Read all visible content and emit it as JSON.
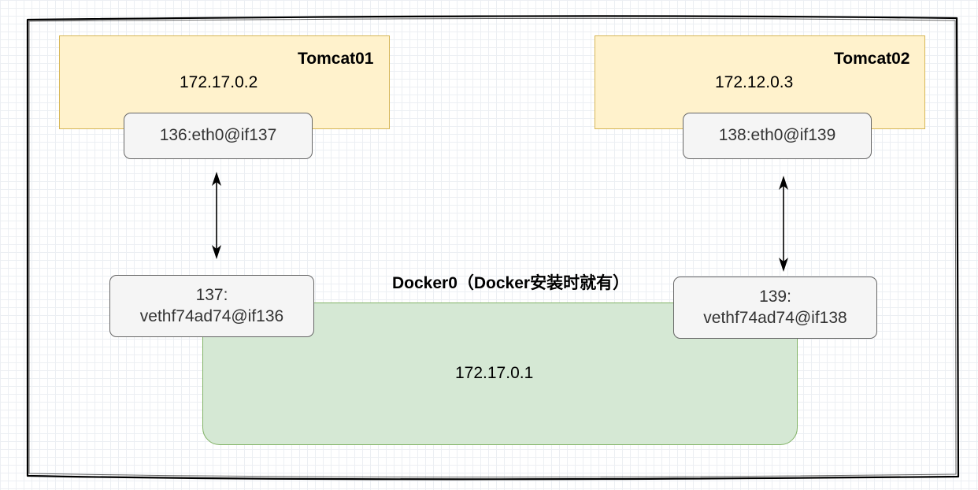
{
  "containers": [
    {
      "name": "Tomcat01",
      "ip": "172.17.0.2",
      "interface": "136:eth0@if137",
      "veth": {
        "line1": "137:",
        "line2": "vethf74ad74@if136"
      }
    },
    {
      "name": "Tomcat02",
      "ip": "172.12.0.3",
      "interface": "138:eth0@if139",
      "veth": {
        "line1": "139:",
        "line2": "vethf74ad74@if138"
      }
    }
  ],
  "bridge": {
    "title": "Docker0（Docker安装时就有）",
    "ip": "172.17.0.1"
  },
  "colors": {
    "container_fill": "#fff2cc",
    "container_border": "#d6b656",
    "interface_fill": "#f5f5f5",
    "interface_border": "#666666",
    "bridge_fill": "#d5e8d4",
    "bridge_border": "#82b366",
    "frame_stroke": "#000000"
  }
}
